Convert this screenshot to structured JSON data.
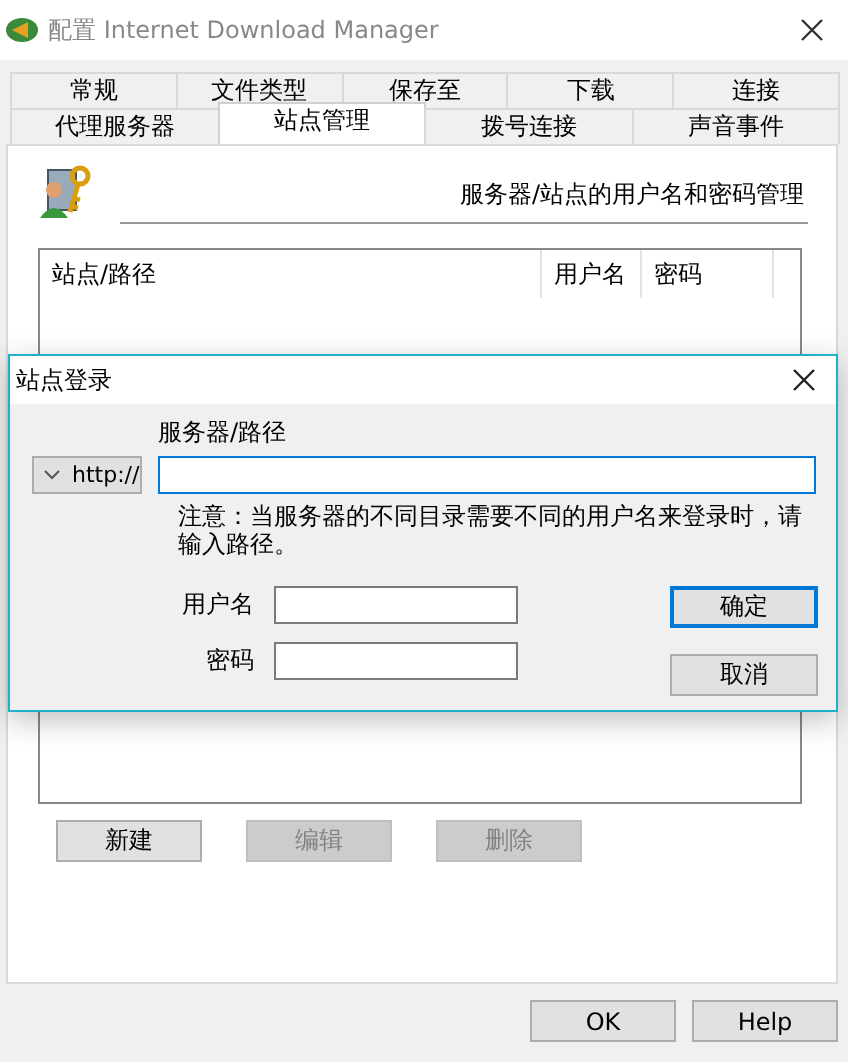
{
  "window": {
    "title": "配置 Internet Download Manager"
  },
  "tab_rows": [
    [
      {
        "label": "常规",
        "selected": false
      },
      {
        "label": "文件类型",
        "selected": false
      },
      {
        "label": "保存至",
        "selected": false
      },
      {
        "label": "下载",
        "selected": false
      },
      {
        "label": "连接",
        "selected": false
      }
    ],
    [
      {
        "label": "代理服务器",
        "selected": false
      },
      {
        "label": "站点管理",
        "selected": true
      },
      {
        "label": "拨号连接",
        "selected": false
      },
      {
        "label": "声音事件",
        "selected": false
      }
    ]
  ],
  "panel": {
    "heading": "服务器/站点的用户名和密码管理",
    "table": {
      "columns": [
        "站点/路径",
        "用户名",
        "密码"
      ]
    },
    "buttons": [
      {
        "label": "新建",
        "disabled": false
      },
      {
        "label": "编辑",
        "disabled": true
      },
      {
        "label": "删除",
        "disabled": true
      }
    ]
  },
  "footer_buttons": [
    "OK",
    "Help"
  ],
  "dialog": {
    "title": "站点登录",
    "protocol": "http://",
    "server_label": "服务器/路径",
    "note": "注意：当服务器的不同目录需要不同的用户名来登录时，请输入路径。",
    "fields": [
      {
        "label": "用户名"
      },
      {
        "label": "密码"
      }
    ],
    "buttons": [
      {
        "label": "确定",
        "default": true
      },
      {
        "label": "取消",
        "default": false
      }
    ]
  }
}
